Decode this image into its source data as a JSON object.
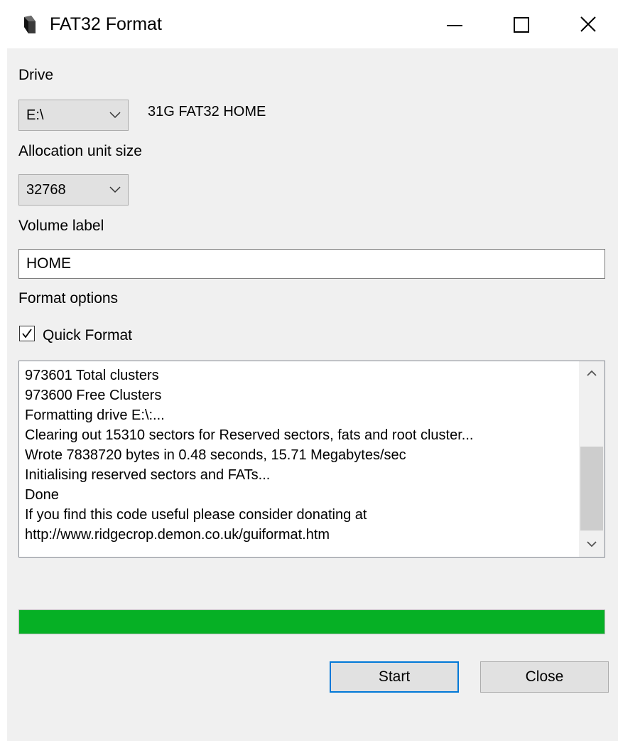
{
  "window": {
    "title": "FAT32 Format",
    "app_icon": "fat32format-app-icon",
    "controls": {
      "minimize_icon": "minimize-icon",
      "maximize_icon": "maximize-icon",
      "close_icon": "close-icon"
    }
  },
  "drive": {
    "label": "Drive",
    "selected": "E:\\",
    "info": "31G FAT32 HOME"
  },
  "allocation": {
    "label": "Allocation unit size",
    "selected": "32768"
  },
  "volume": {
    "label": "Volume label",
    "value": "HOME"
  },
  "format_options": {
    "label": "Format options",
    "quick_format_label": "Quick Format",
    "quick_format_checked": true
  },
  "log": {
    "lines": [
      "973601 Total clusters",
      "973600 Free Clusters",
      "Formatting drive E:\\:...",
      "Clearing out 15310 sectors for Reserved sectors, fats and root cluster...",
      "Wrote 7838720 bytes in 0.48 seconds, 15.71 Megabytes/sec",
      "Initialising reserved sectors and FATs...",
      "Done",
      "If you find this code useful please consider donating at",
      "http://www.ridgecrop.demon.co.uk/guiformat.htm"
    ]
  },
  "progress": {
    "percent": 100,
    "color": "#06b025"
  },
  "buttons": {
    "start": "Start",
    "close": "Close"
  },
  "colors": {
    "accent_focus": "#0078d7",
    "client_bg": "#f0f0f0"
  }
}
